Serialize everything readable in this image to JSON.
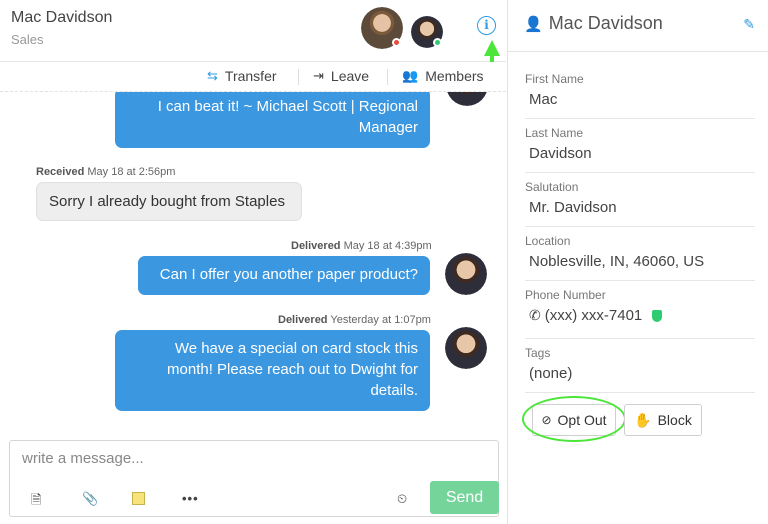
{
  "header": {
    "name": "Mac Davidson",
    "department": "Sales"
  },
  "toolbar": {
    "transfer": "Transfer",
    "leave": "Leave",
    "members": "Members"
  },
  "messages": [
    {
      "direction": "out",
      "meta_status": "",
      "meta_time": "",
      "text": "I can beat it! ~ Michael Scott | Regional Manager"
    },
    {
      "direction": "in",
      "meta_status": "Received",
      "meta_time": "May 18 at 2:56pm",
      "text": "Sorry I already bought from Staples"
    },
    {
      "direction": "out",
      "meta_status": "Delivered",
      "meta_time": "May 18 at 4:39pm",
      "text": "Can I offer you another paper product?"
    },
    {
      "direction": "out",
      "meta_status": "Delivered",
      "meta_time": "Yesterday at 1:07pm",
      "text": "We have a special on card stock this month! Please reach out to Dwight for details."
    }
  ],
  "compose": {
    "placeholder": "write a message...",
    "send": "Send"
  },
  "contact": {
    "title": "Mac Davidson",
    "fields": [
      {
        "label": "First Name",
        "value": "Mac"
      },
      {
        "label": "Last Name",
        "value": "Davidson"
      },
      {
        "label": "Salutation",
        "value": "Mr. Davidson"
      },
      {
        "label": "Location",
        "value": "Noblesville, IN, 46060, US"
      },
      {
        "label": "Phone Number",
        "value": "(xxx) xxx-7401"
      },
      {
        "label": "Tags",
        "value": "(none)"
      }
    ],
    "opt_out": "Opt Out",
    "block": "Block"
  },
  "colors": {
    "accent": "#3a97e0",
    "send": "#74d49a",
    "highlight": "#4ce63a",
    "verified": "#2ecc71"
  }
}
